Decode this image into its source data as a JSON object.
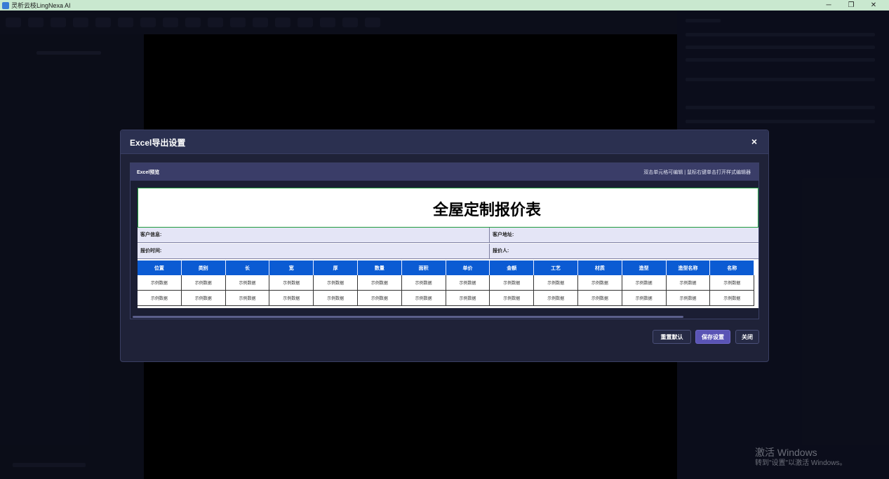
{
  "window": {
    "title": "灵析云枝LingNexa AI",
    "controls": [
      "─",
      "❐",
      "✕"
    ]
  },
  "watermark": {
    "line1": "激活 Windows",
    "line2": "转到\"设置\"以激活 Windows。"
  },
  "dialog": {
    "title": "Excel导出设置",
    "close": "×",
    "preview": {
      "label": "Excel预览",
      "hint": "双击单元格可编辑 | 鼠标右键单击打开样式编辑器"
    },
    "sheet": {
      "title": "全屋定制报价表",
      "info": [
        {
          "left": "客户信息:",
          "right": "客户地址:"
        },
        {
          "left": "报价时间:",
          "right": "报价人:"
        }
      ],
      "columns": [
        "位置",
        "类别",
        "长",
        "宽",
        "厚",
        "数量",
        "面积",
        "单价",
        "金额",
        "工艺",
        "材质",
        "造型",
        "造型名称",
        "名称"
      ],
      "rows": [
        [
          "示例数据",
          "示例数据",
          "示例数据",
          "示例数据",
          "示例数据",
          "示例数据",
          "示例数据",
          "示例数据",
          "示例数据",
          "示例数据",
          "示例数据",
          "示例数据",
          "示例数据",
          "示例数据"
        ],
        [
          "示例数据",
          "示例数据",
          "示例数据",
          "示例数据",
          "示例数据",
          "示例数据",
          "示例数据",
          "示例数据",
          "示例数据",
          "示例数据",
          "示例数据",
          "示例数据",
          "示例数据",
          "示例数据"
        ]
      ]
    },
    "buttons": {
      "reset": "重置默认",
      "save": "保存设置",
      "close": "关闭"
    }
  }
}
